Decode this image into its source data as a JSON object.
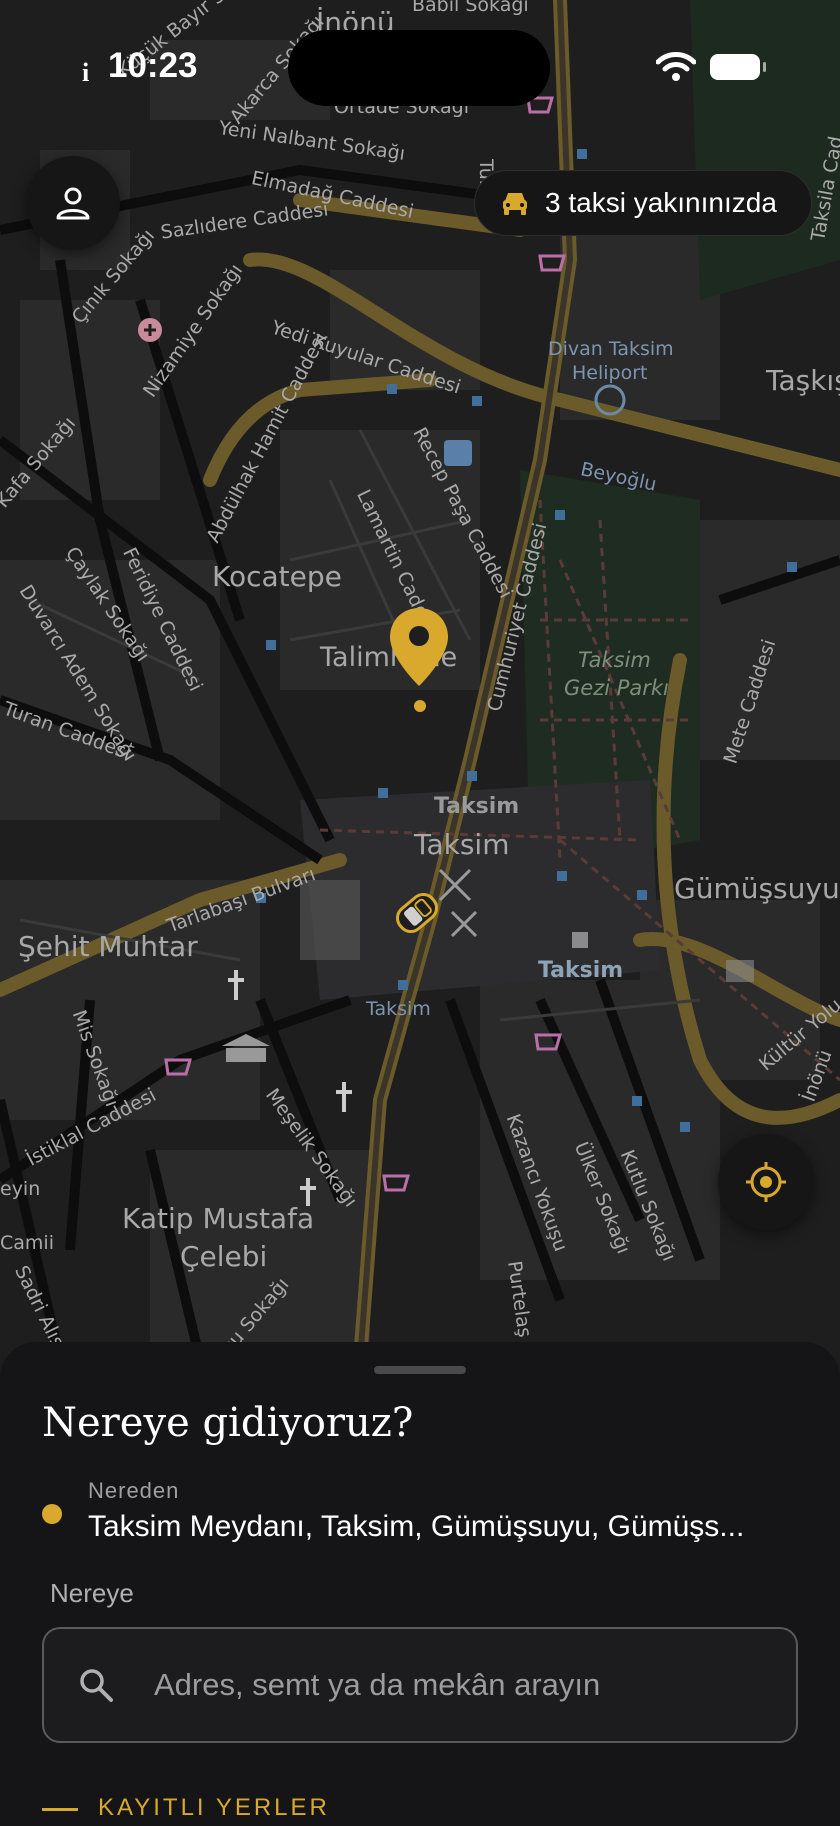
{
  "status_bar": {
    "time": "10:23"
  },
  "map": {
    "labels": {
      "inonu": "İnönü",
      "babil": "Babil Sokağı",
      "kucuk_bayir": "Küçük Bayır Sok.",
      "akarca": "Akarca Sokağı",
      "ortade": "Ortade Sokağı",
      "turna": "Turna",
      "yeni_nalbant": "Yeni Nalbant Sokağı",
      "elmadag": "Elmadağ Caddesi",
      "sazlidere": "Sazlıdere Caddesi",
      "cinik": "Çınık Sokağı",
      "taksila": "Taksila Cad",
      "nizamiye": "Nizamiye Sokağı",
      "yedi_kuyular": "Yedi Kuyular Caddesi",
      "divan": "Divan Taksim",
      "heliport": "Heliport",
      "taskisla": "Taşkış",
      "abdulhak": "Abdülhak Hamit Caddesi",
      "recep_pasa": "Recep Paşa Caddesi",
      "beyoglu": "Beyoğlu",
      "lamartin": "Lamartin Cadde",
      "kafa": "Kafa Sokağı",
      "caylak": "Çaylak Sokağı",
      "feridiye": "Feridiye Caddesi",
      "kocatepe": "Kocatepe",
      "duvarci": "Duvarcı Adem Sokağı",
      "cumhuriyet": "Cumhuriyet Caddesi",
      "gezi1": "Taksim",
      "gezi2": "Gezi Parkı",
      "talimhane": "Talimhane",
      "mete": "Mete Caddesi",
      "turan": "Turan Caddesi",
      "taksim_bold": "Taksim",
      "taksim": "Taksim",
      "tarlabasi": "Tarlabaşı Bulvarı",
      "gumussuyu": "Gümüşsuyu",
      "sehit_muhtar": "Şehit Muhtar",
      "taksim_bold2": "Taksim",
      "taksim_small": "Taksim",
      "mis": "Mis Sokağı",
      "kultur": "Kültür Yolu",
      "inonu2": "İnönü",
      "meselik": "Meşelik Sokağı",
      "istiklal": "İstiklal Caddesi",
      "kazanci": "Kazancı Yokuşu",
      "ulker": "Ülker Sokağı",
      "kutlu": "Kutlu Sokağı",
      "katip1": "Katip Mustafa",
      "katip2": "Çelebi",
      "sadri": "Sadri Alışık Sk.",
      "purtelas": "Purtelaş Sk.",
      "eyin": "eyin",
      "camii": "Camii",
      "soku": "cu Sokağı"
    }
  },
  "taxi_badge": {
    "text": "3 taksi yakınınızda"
  },
  "sheet": {
    "title": "Nereye gidiyoruz?",
    "from_label": "Nereden",
    "from_value": "Taksim Meydanı, Taksim, Gümüşsuyu, Gümüşs...",
    "to_label": "Nereye",
    "search_placeholder": "Adres, semt ya da mekân arayın",
    "saved_title": "KAYITLI YERLER"
  },
  "colors": {
    "accent": "#d8a92c",
    "sheet_bg": "#151517",
    "map_bg": "#1e1e1e"
  },
  "icons": {
    "profile": "person-icon",
    "taxi": "car-icon",
    "locate": "crosshair-icon",
    "search": "search-icon",
    "pin": "map-pin-icon"
  }
}
